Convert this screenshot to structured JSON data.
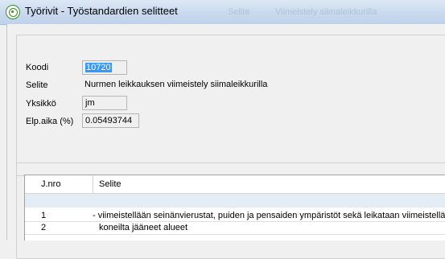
{
  "window": {
    "title": "Työrivit - Työstandardien selitteet",
    "ghost_texts": [
      "Selite",
      "Viimeistely siimaleikkurilla"
    ]
  },
  "form": {
    "koodi": {
      "label": "Koodi",
      "value": "10720"
    },
    "selite": {
      "label": "Selite",
      "value": "Nurmen leikkauksen viimeistely siimaleikkurilla"
    },
    "yksikko": {
      "label": "Yksikkö",
      "value": "jm"
    },
    "elp_aika": {
      "label": "Elp.aika (%)",
      "value": "0.05493744"
    }
  },
  "grid": {
    "columns": [
      "J.nro",
      "Selite"
    ],
    "rows": [
      {
        "nro": "1",
        "selite": "- viimeistellään seinänvierustat, puiden ja pensaiden ympäristöt sekä leikataan viimeistellään"
      },
      {
        "nro": "2",
        "selite": "koneilta jääneet alueet"
      }
    ]
  },
  "colors": {
    "selection": "#3399ff",
    "titlebar": "#c9d9ee",
    "grid_highlight": "#e4ecf6"
  }
}
